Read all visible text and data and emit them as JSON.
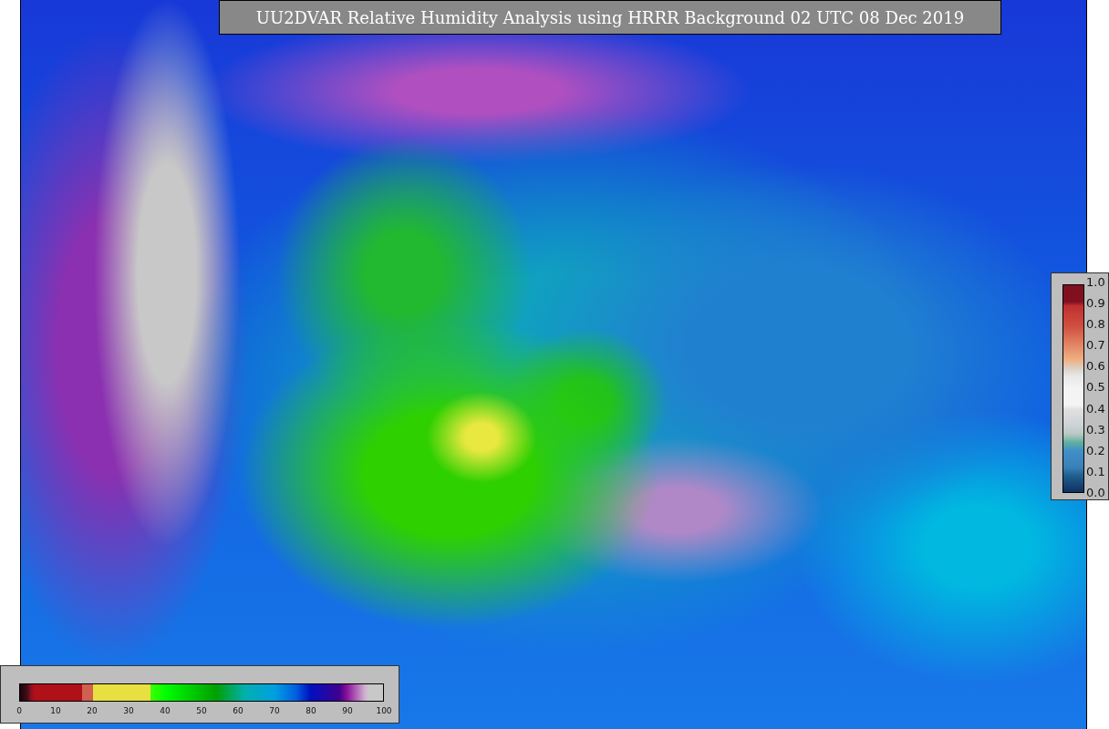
{
  "title": "UU2DVAR Relative Humidity Analysis using HRRR Background 02 UTC 08 Dec 2019",
  "humidity_colorbar": {
    "ticks": [
      "0",
      "10",
      "20",
      "30",
      "40",
      "50",
      "60",
      "70",
      "80",
      "90",
      "100"
    ]
  },
  "station_colorbar": {
    "ticks": [
      "1.0",
      "0.9",
      "0.8",
      "0.7",
      "0.6",
      "0.5",
      "0.4",
      "0.3",
      "0.2",
      "0.1",
      "0.0"
    ]
  }
}
